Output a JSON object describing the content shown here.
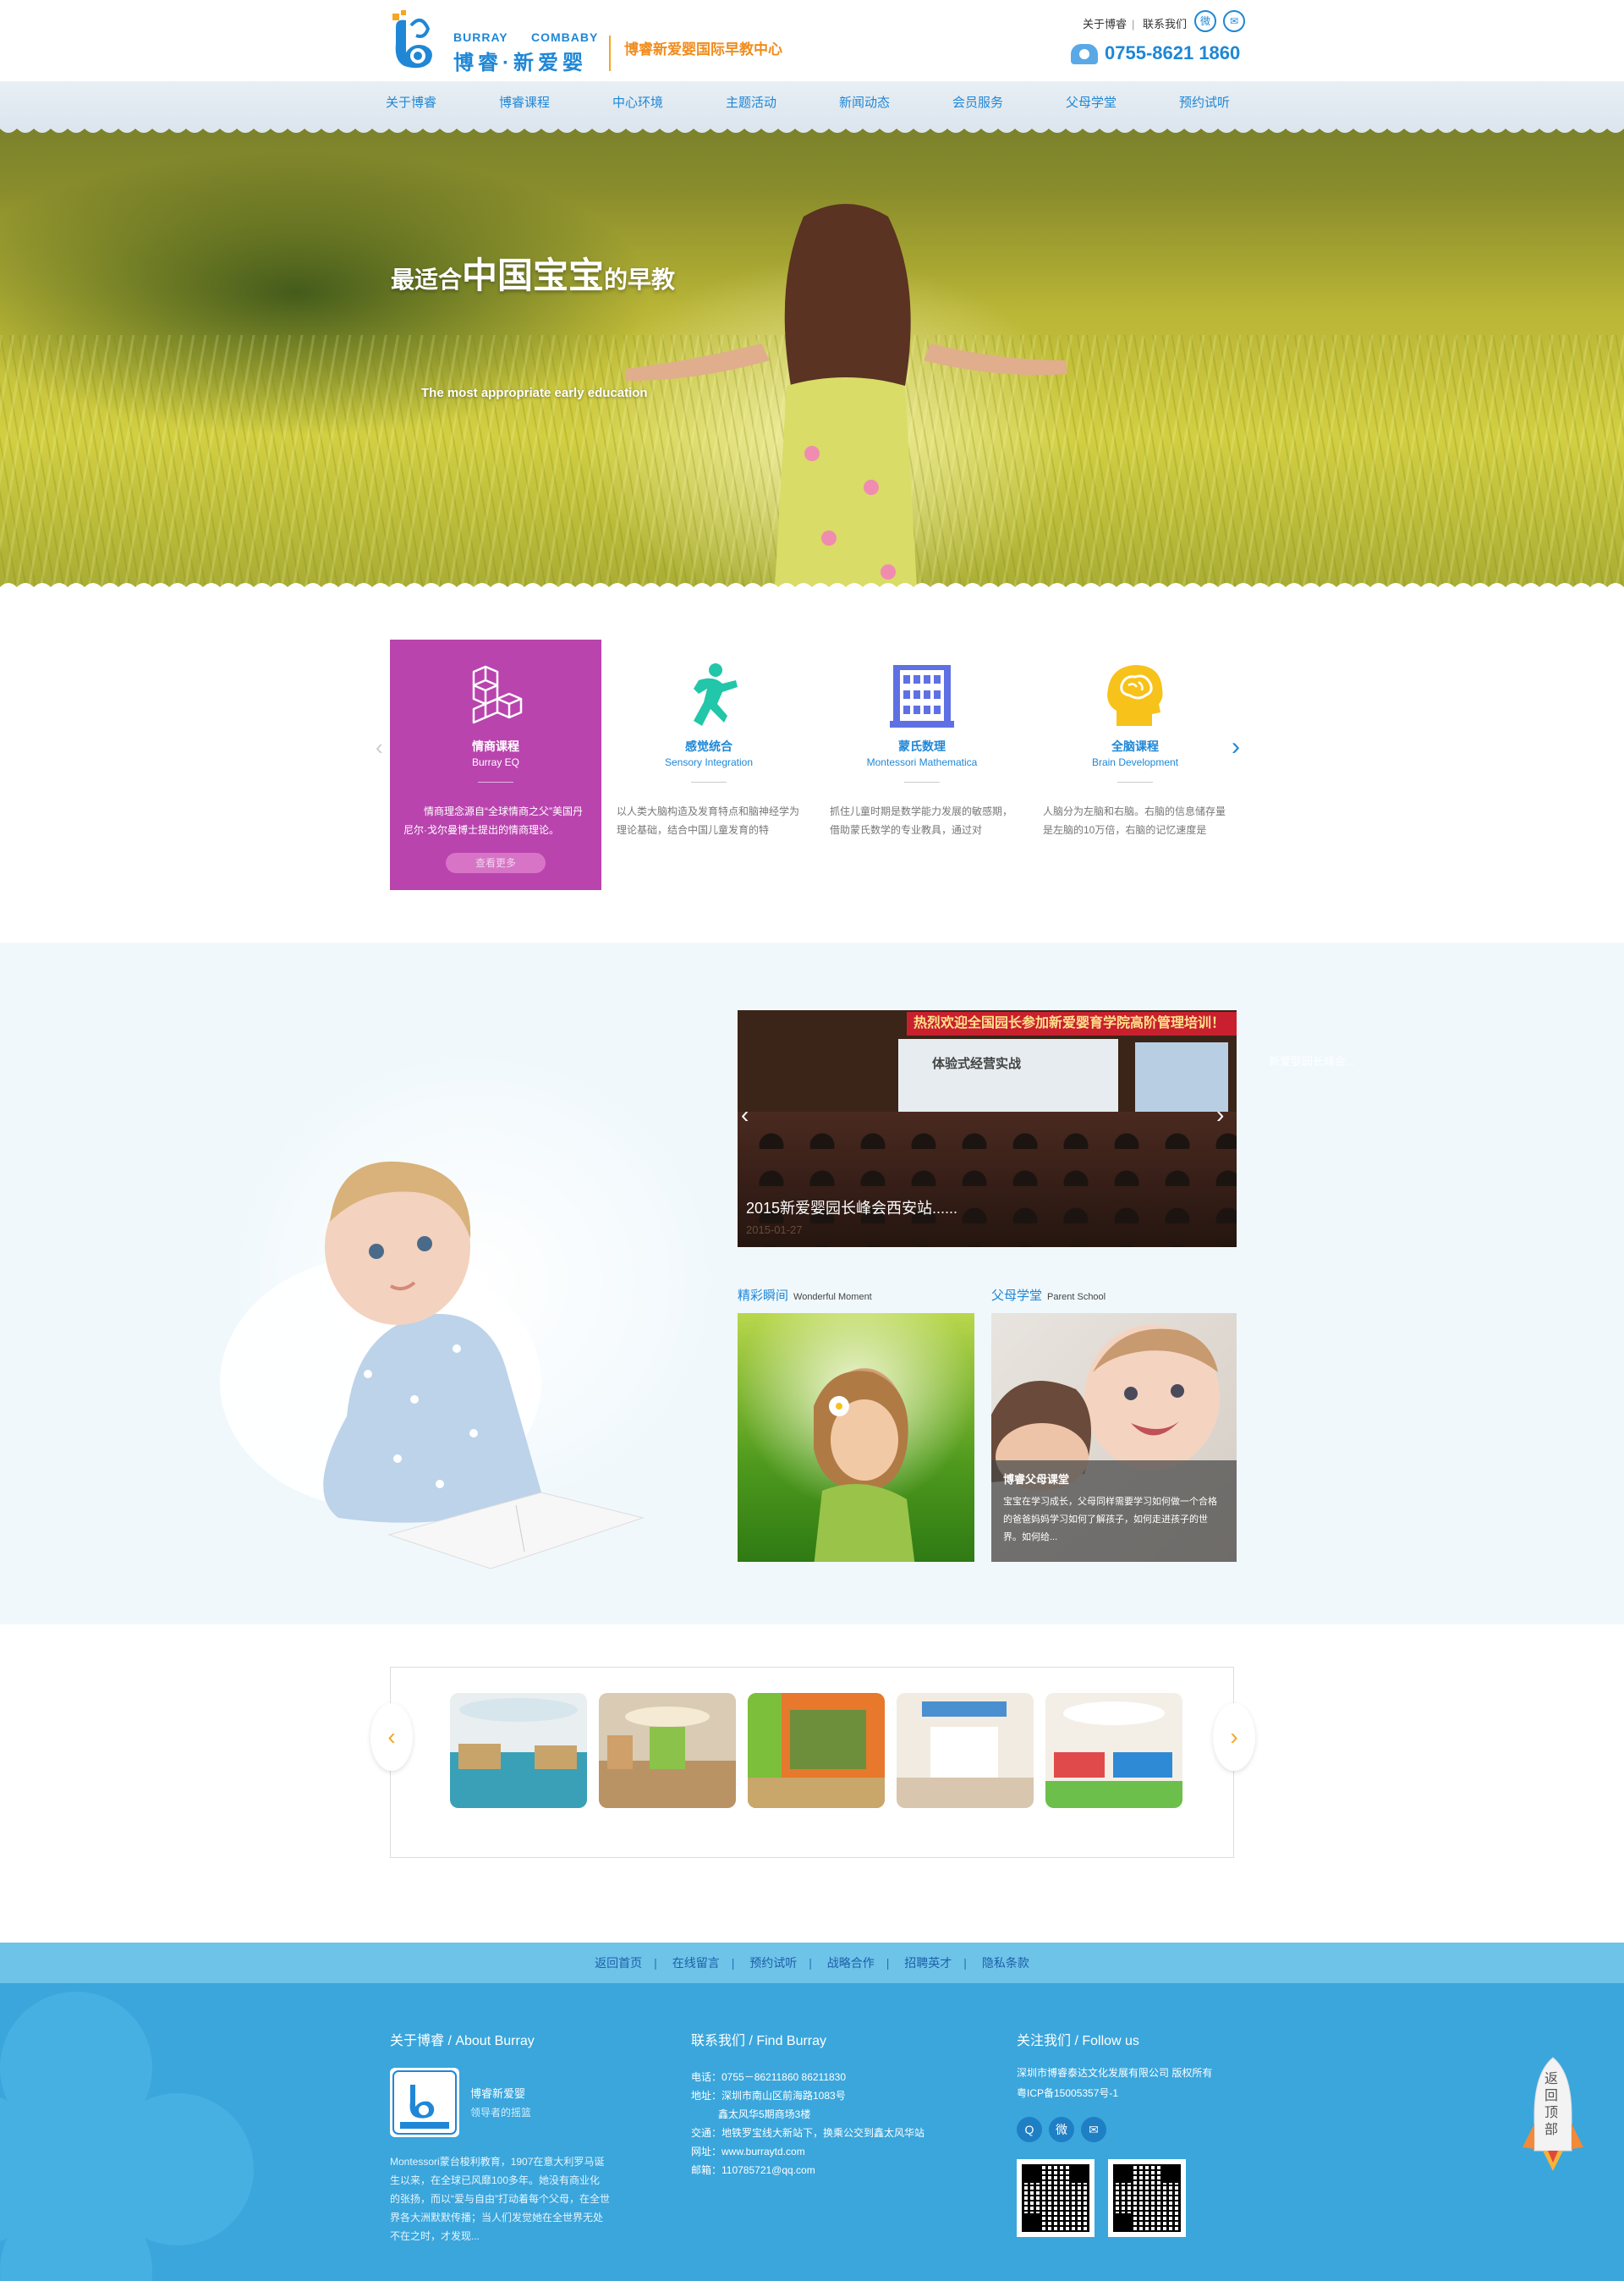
{
  "header": {
    "logo_en_1": "BURRAY",
    "logo_en_2": "COMBABY",
    "logo_cn": "博睿·新爱婴",
    "tagline": "博睿新爱婴国际早教中心",
    "top_links": [
      "关于博睿",
      "联系我们"
    ],
    "top_sep": "|",
    "phone": "0755-8621 1860",
    "social_icons": [
      "weibo-icon",
      "wechat-icon"
    ],
    "social_glyphs": [
      "微",
      "✉"
    ]
  },
  "nav": {
    "items": [
      "关于博睿",
      "博睿课程",
      "中心环境",
      "主题活动",
      "新闻动态",
      "会员服务",
      "父母学堂",
      "预约试听"
    ]
  },
  "hero": {
    "title_pre": "最适合",
    "title_big": "中国宝宝",
    "title_post": "的早教",
    "subtitle": "The most appropriate early education"
  },
  "courses": {
    "prev_arrow": "‹",
    "next_arrow": "›",
    "items": [
      {
        "title": "情商课程",
        "en": "Burray EQ",
        "desc": "情商理念源自“全球情商之父”美国丹尼尔·戈尔曼博士提出的情商理论。",
        "more": "查看更多",
        "icon": "blocks-icon",
        "color": "#b944ae"
      },
      {
        "title": "感觉统合",
        "en": "Sensory Integration",
        "desc": "以人类大脑构造及发育特点和脑神经学为理论基础，结合中国儿童发育的特",
        "icon": "running-figure-icon",
        "color": "#22c6a8"
      },
      {
        "title": "蒙氏数理",
        "en": "Montessori Mathematica",
        "desc": "抓住儿童时期是数学能力发展的敏感期，借助蒙氏数学的专业教具，通过对",
        "icon": "abacus-icon",
        "color": "#5f70e4"
      },
      {
        "title": "全脑课程",
        "en": "Brain Development",
        "desc": "人脑分为左脑和右脑。右脑的信息储存量是左脑的10万倍，右脑的记忆速度是",
        "icon": "brain-head-icon",
        "color": "#f7c21a"
      }
    ]
  },
  "news": {
    "banner": "热烈欢迎全国园长参加新爱婴育学院高阶管理培训！",
    "screen_text": "体验式经营实战",
    "caption": "2015新爱婴园长峰会西安站......",
    "date": "2015-01-27",
    "ghost_text": "新爱婴园长峰会...",
    "arrow_left": "‹",
    "arrow_right": "›"
  },
  "moments": {
    "title": "精彩瞬间",
    "en": "Wonderful Moment"
  },
  "parent_school": {
    "title": "父母学堂",
    "en": "Parent School",
    "card_title": "博睿父母课堂",
    "card_desc": "宝宝在学习成长，父母同样需要学习如何做一个合格的爸爸妈妈学习如何了解孩子，如何走进孩子的世界。如何给..."
  },
  "environment": {
    "prev_arrow": "‹",
    "next_arrow": "›",
    "thumbs": [
      "library-room",
      "hall-room",
      "activity-room",
      "entrance-room",
      "play-room"
    ]
  },
  "footer": {
    "links": [
      "返回首页",
      "在线留言",
      "预约试听",
      "战略合作",
      "招聘英才",
      "隐私条款"
    ],
    "link_sep": "|",
    "about_title": "关于博睿 / About Burray",
    "brand": "博睿新爱婴",
    "brand_sub": "领导者的摇篮",
    "about_text": "Montessori蒙台梭利教育，1907在意大利罗马诞生以来，在全球已风靡100多年。她没有商业化的张扬，而以“爱与自由”打动着每个父母，在全世界各大洲默默传播；当人们发觉她在全世界无处不在之时，才发现...",
    "contact_title": "联系我们 / Find Burray",
    "contact_lines": [
      "电话：0755－86211860  86211830",
      "地址：深圳市南山区前海路1083号",
      "鑫太风华5期商场3楼",
      "交通：地铁罗宝线大新站下，换乘公交到鑫太风华站",
      "网址：www.burraytd.com",
      "邮箱：110785721@qq.com"
    ],
    "follow_title": "关注我们 / Follow us",
    "copyright": "深圳市博睿泰达文化发展有限公司 版权所有",
    "icp": "粤ICP备15005357号-1",
    "social": [
      "qq-icon",
      "weibo-icon",
      "wechat-icon"
    ],
    "social_glyphs": [
      "Q",
      "微",
      "✉"
    ],
    "back_to_top": "返回顶部"
  }
}
